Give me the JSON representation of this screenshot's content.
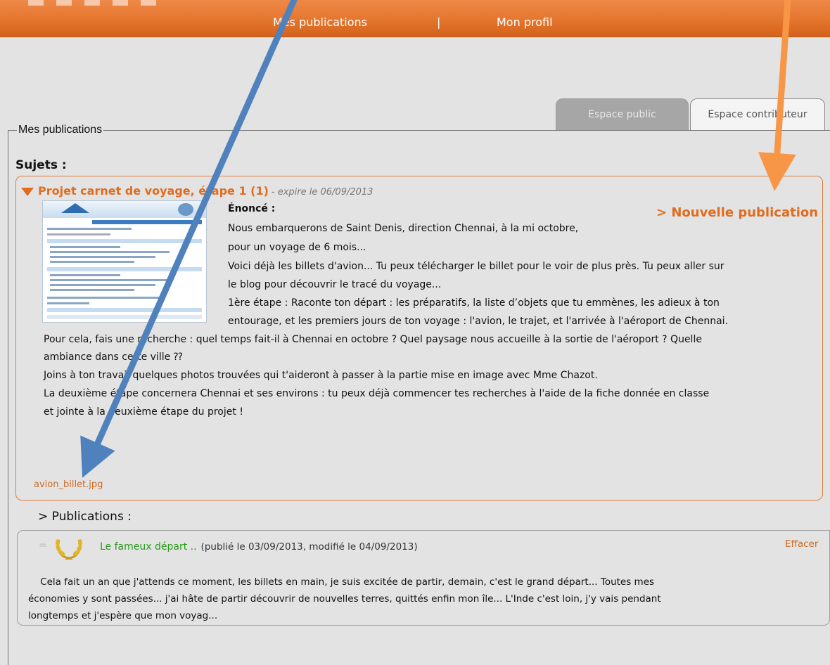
{
  "nav": {
    "item_publications": "Mes publications",
    "separator": "|",
    "item_profile": "Mon profil"
  },
  "tabs": {
    "public": "Espace public",
    "contributor": "Espace contributeur"
  },
  "section": {
    "legend": "Mes publications",
    "subjects_heading": "Sujets :"
  },
  "subject": {
    "title": "Projet carnet de voyage, étape 1 (1)",
    "expiry": "- expire le 06/09/2013",
    "instructions_label": "Énoncé :",
    "new_publication_link": "> Nouvelle publication",
    "instructions_lines": [
      "Nous embarquerons de Saint Denis, direction Chennai, à la mi octobre,",
      "pour un voyage de 6 mois...",
      "Voici déjà les billets d'avion... Tu peux télécharger le billet pour le voir de plus près. Tu peux aller sur",
      "le blog pour découvrir le tracé du voyage...",
      "1ère étape : Raconte ton départ : les préparatifs, la liste d’objets que tu emmènes, les adieux à ton",
      "entourage, et les premiers jours de ton voyage : l'avion, le trajet, et l'arrivée à l'aéroport de Chennai.",
      "Pour cela, fais une recherche : quel temps fait-il à Chennai en octobre ? Quel paysage nous accueille à la sortie de l'aéroport ? Quelle",
      "ambiance dans cette ville ⁇",
      "Joins à ton travail quelques photos trouvées qui t'aideront à passer à la partie mise en image avec Mme Chazot.",
      "La deuxième étape concernera Chennai et ses environs : tu peux déjà commencer tes recherches à l'aide de la fiche donnée en classe",
      "et jointe à la deuxième étape  du projet !"
    ],
    "attachment": "avion_billet.jpg"
  },
  "publications": {
    "heading": "> Publications :",
    "items": [
      {
        "collapse_symbol": "=",
        "title": "Le fameux départ ..",
        "meta": "(publié le 03/09/2013, modifié le 04/09/2013)",
        "delete_label": "Effacer",
        "excerpt_lines": [
          "    Cela fait un an que j'attends ce moment, les billets en main, je suis excitée de partir, demain, c'est le grand départ... Toutes mes",
          "économies y sont passées... j'ai hâte de partir découvrir de nouvelles terres, quittés enfin mon île... L'Inde c'est loin, j'y vais pendant",
          "longtemps et j'espère que mon voyag..."
        ]
      }
    ]
  },
  "colors": {
    "nav_bar": "#e5762e",
    "accent_orange": "#e06c1f",
    "pub_title_green": "#2a9a1c",
    "arrow_blue": "#4f81bd",
    "arrow_orange": "#f79646"
  }
}
